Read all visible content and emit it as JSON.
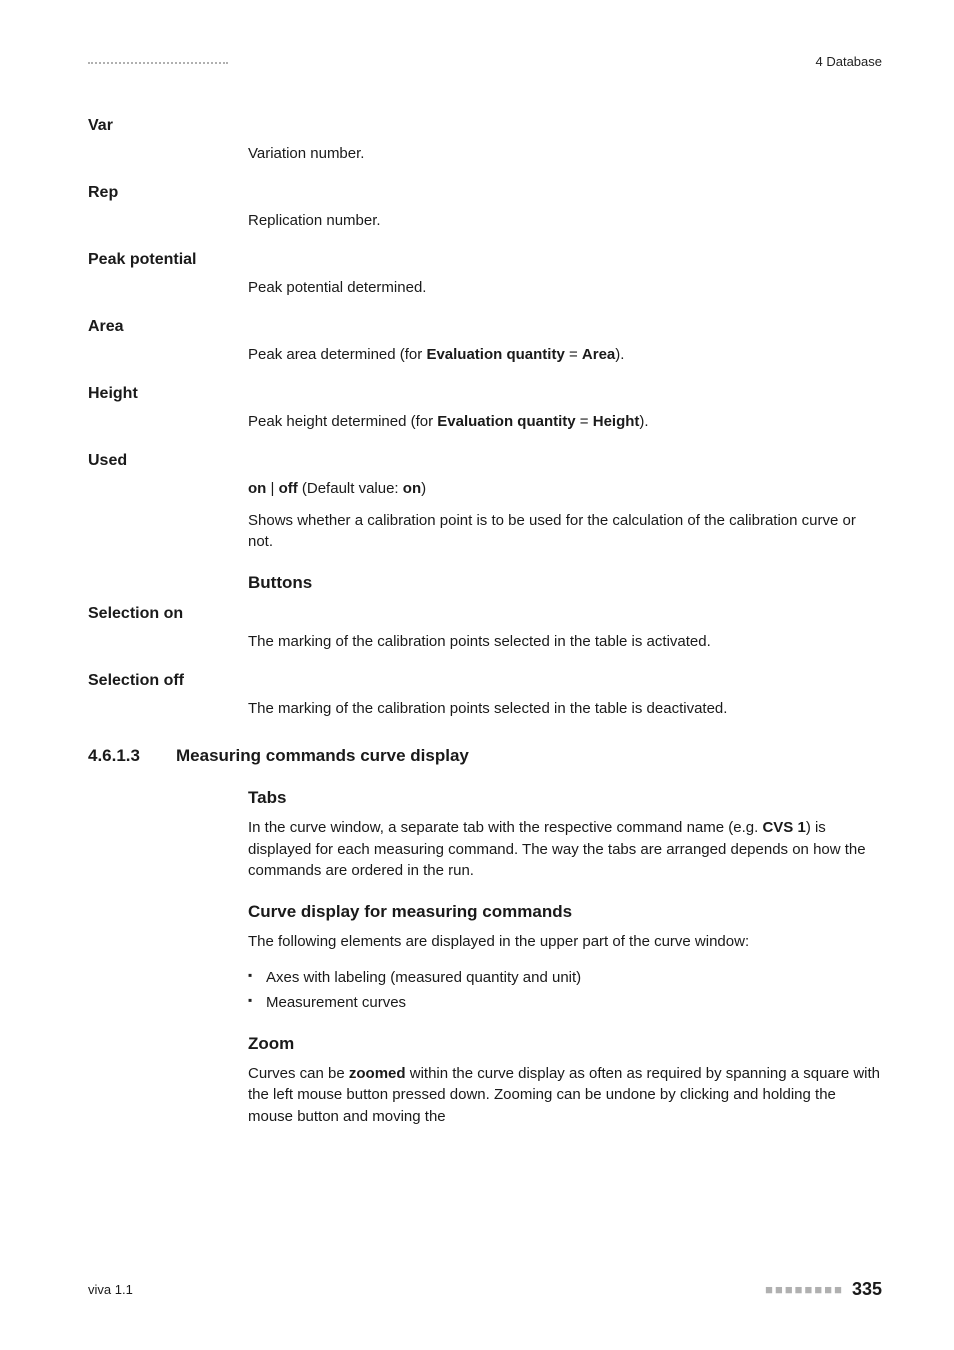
{
  "header": {
    "right_label": "4 Database"
  },
  "defs": {
    "var": {
      "term": "Var",
      "body": "Variation number."
    },
    "rep": {
      "term": "Rep",
      "body": "Replication number."
    },
    "peak_potential": {
      "term": "Peak potential",
      "body": "Peak potential determined."
    },
    "area": {
      "term": "Area",
      "body_pre": "Peak area determined (for ",
      "body_bold1": "Evaluation quantity",
      "body_mid": " = ",
      "body_bold2": "Area",
      "body_post": ")."
    },
    "height": {
      "term": "Height",
      "body_pre": "Peak height determined (for ",
      "body_bold1": "Evaluation quantity",
      "body_mid": " = ",
      "body_bold2": "Height",
      "body_post": ")."
    },
    "used": {
      "term": "Used",
      "line1_b1": "on",
      "line1_sep": " | ",
      "line1_b2": "off",
      "line1_paren_pre": " (Default value: ",
      "line1_b3": "on",
      "line1_paren_post": ")",
      "line2": "Shows whether a calibration point is to be used for the calculation of the calibration curve or not."
    }
  },
  "buttons": {
    "heading": "Buttons",
    "selection_on": {
      "term": "Selection on",
      "body": "The marking of the calibration points selected in the table is activated."
    },
    "selection_off": {
      "term": "Selection off",
      "body": "The marking of the calibration points selected in the table is deactivated."
    }
  },
  "section": {
    "number": "4.6.1.3",
    "title": "Measuring commands curve display",
    "tabs": {
      "heading": "Tabs",
      "body_pre": "In the curve window, a separate tab with the respective command name (e.g. ",
      "body_bold": "CVS 1",
      "body_post": ") is displayed for each measuring command. The way the tabs are arranged depends on how the commands are ordered in the run."
    },
    "curve_display": {
      "heading": "Curve display for measuring commands",
      "intro": "The following elements are displayed in the upper part of the curve window:",
      "bullets": {
        "b0": "Axes with labeling (measured quantity and unit)",
        "b1": "Measurement curves"
      }
    },
    "zoom": {
      "heading": "Zoom",
      "body_pre": "Curves can be ",
      "body_bold": "zoomed",
      "body_post": " within the curve display as often as required by spanning a square with the left mouse button pressed down. Zooming can be undone by clicking and holding the mouse button and moving the"
    }
  },
  "footer": {
    "left": "viva 1.1",
    "dots": "■■■■■■■■",
    "page": "335"
  }
}
